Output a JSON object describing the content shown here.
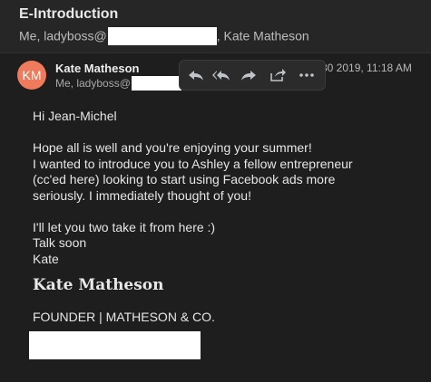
{
  "email": {
    "subject": "E-Introduction",
    "participants_prefix": "Me, ladyboss@",
    "participants_suffix": ", Kate Matheson"
  },
  "message": {
    "avatar_initials": "KM",
    "avatar_color": "#f07a5c",
    "sender": "Kate Matheson",
    "to_prefix": "Me, ladyboss@",
    "date": "30 2019, 11:18 AM",
    "toolbar": {
      "reply_icon": "reply-icon",
      "reply_all_icon": "reply-all-icon",
      "forward_icon": "forward-icon",
      "share_icon": "share-icon",
      "more_icon": "more-icon"
    },
    "body": {
      "greeting": "Hi Jean-Michel",
      "p1_l1": "Hope all is well and you're enjoying your summer!",
      "p1_l2": "I wanted to introduce you to Ashley a fellow entrepreneur",
      "p1_l3": "(cc'ed here) looking to start using Facebook ads more",
      "p1_l4": "seriously. I immediately thought of you!",
      "p2_l1": "I'll let you two take it from here :)",
      "p2_l2": "Talk soon",
      "p2_l3": "Kate"
    },
    "signature": {
      "name": "Kate Matheson",
      "title": "FOUNDER | MATHESON & CO."
    }
  }
}
